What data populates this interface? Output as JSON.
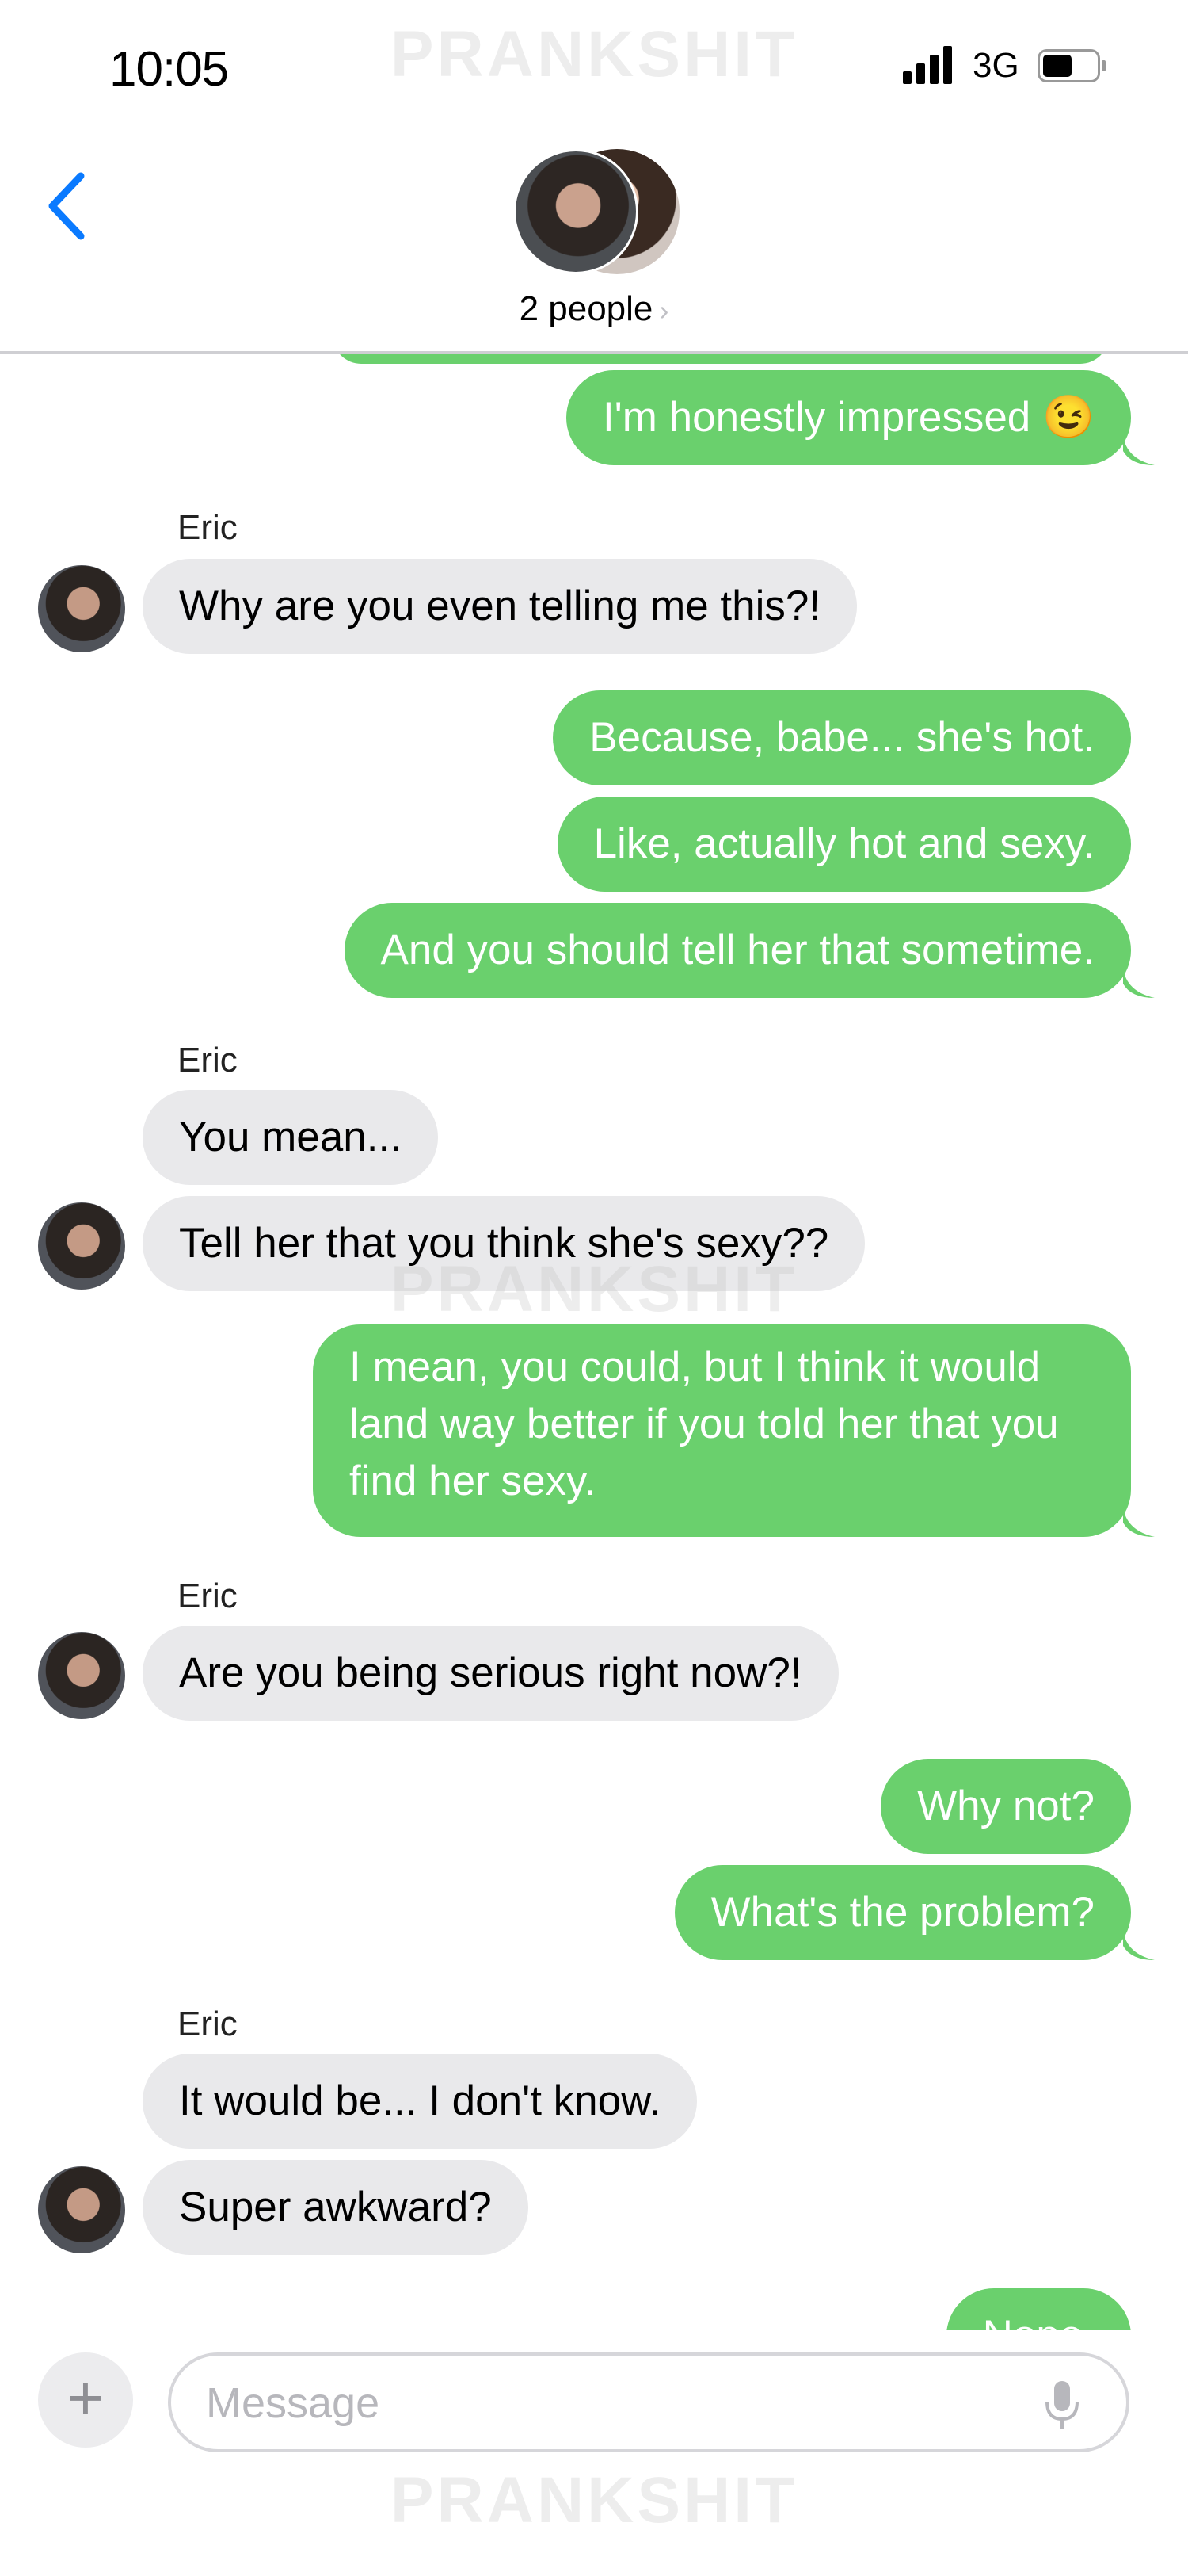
{
  "status_bar": {
    "time": "10:05",
    "network": "3G"
  },
  "watermark": "PRANKSHIT",
  "header": {
    "title": "2 people",
    "chevron": "›"
  },
  "messages": [
    {
      "side": "out",
      "text": "I'm honestly impressed 😉"
    },
    {
      "sender": "Eric"
    },
    {
      "side": "in",
      "text": "Why are you even telling me this?!"
    },
    {
      "side": "out",
      "text": "Because, babe... she's hot."
    },
    {
      "side": "out",
      "text": "Like, actually hot and sexy."
    },
    {
      "side": "out",
      "text": "And you should tell her that sometime."
    },
    {
      "sender": "Eric"
    },
    {
      "side": "in",
      "text": "You mean..."
    },
    {
      "side": "in",
      "text": "Tell her that you think she's sexy??"
    },
    {
      "side": "out",
      "text": "I mean, you could, but I think it would land way better if you told her that you find her sexy."
    },
    {
      "sender": "Eric"
    },
    {
      "side": "in",
      "text": "Are you being serious right now?!"
    },
    {
      "side": "out",
      "text": "Why not?"
    },
    {
      "side": "out",
      "text": "What's the problem?"
    },
    {
      "sender": "Eric"
    },
    {
      "side": "in",
      "text": "It would be... I don't know."
    },
    {
      "side": "in",
      "text": "Super awkward?"
    },
    {
      "side": "out",
      "text": "Nope."
    }
  ],
  "input": {
    "placeholder": "Message",
    "plus": "+"
  },
  "icons": [
    "back-chevron-icon",
    "signal-icon",
    "battery-icon",
    "plus-icon",
    "microphone-icon"
  ],
  "colors": {
    "outgoing": "#6ad06d",
    "incoming": "#e9e9eb",
    "accent": "#0a7aff"
  }
}
